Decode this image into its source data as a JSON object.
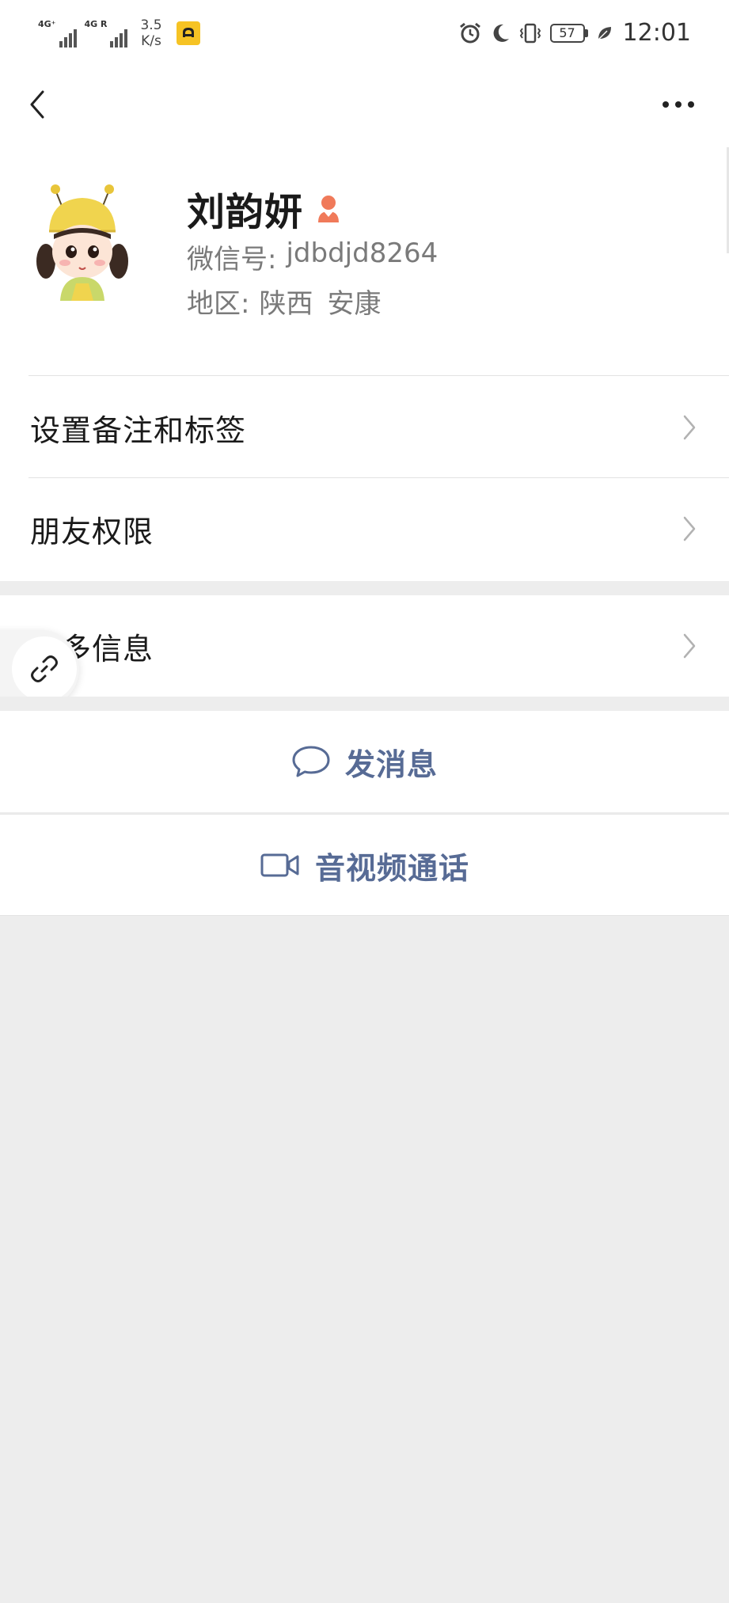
{
  "status_bar": {
    "sim1": "4G⁺",
    "sim2": "4G R",
    "net_speed_value": "3.5",
    "net_speed_unit": "K/s",
    "battery_level": "57",
    "time": "12:01",
    "icons": [
      "alarm-icon",
      "moon-icon",
      "vibrate-icon",
      "battery-icon",
      "leaf-icon"
    ]
  },
  "nav": {
    "back_icon": "back-arrow-icon",
    "more_icon": "more-icon"
  },
  "profile": {
    "name": "刘韵妍",
    "gender_icon": "female-icon",
    "wechat_id_label": "微信号:",
    "wechat_id": "jdbdjd8264",
    "region_label": "地区:",
    "region_province": "陕西",
    "region_city": "安康"
  },
  "menu": {
    "set_remarks": "设置备注和标签",
    "friend_permissions": "朋友权限",
    "more_info": "更多信息"
  },
  "actions": {
    "send_message": "发消息",
    "video_call": "音视频通话"
  },
  "colors": {
    "link_blue": "#576b95",
    "page_bg": "#ededed",
    "female_icon": "#f07a5a"
  }
}
